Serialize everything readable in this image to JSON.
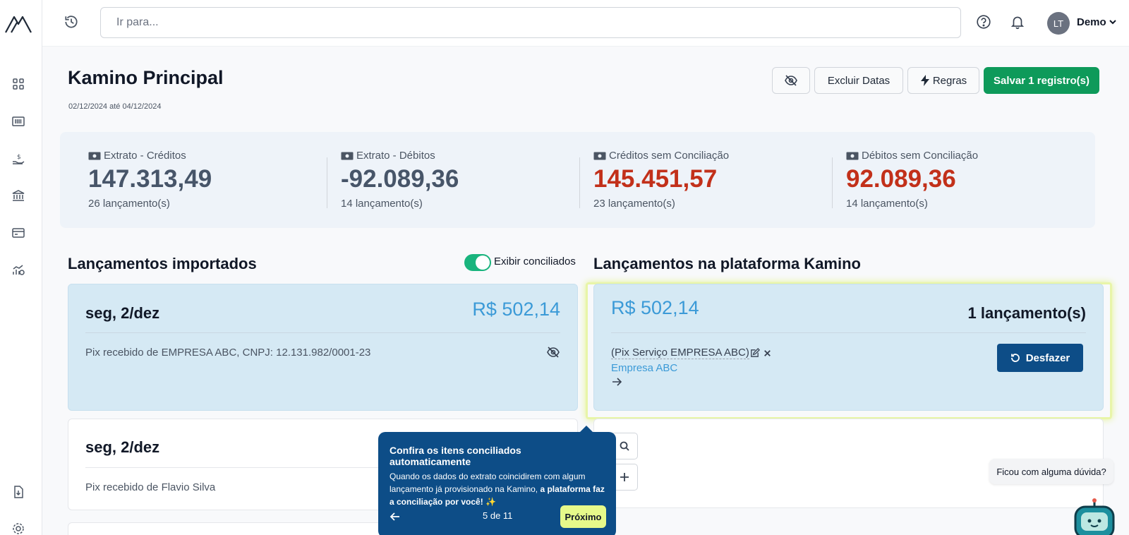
{
  "topbar": {
    "search_placeholder": "Ir para...",
    "user_initials": "LT",
    "user_name": "Demo"
  },
  "page": {
    "title": "Kamino Principal",
    "date_range": "02/12/2024 até 04/12/2024"
  },
  "actions": {
    "excluir_label": "Excluir Datas",
    "regras_label": "Regras",
    "salvar_label": "Salvar 1 registro(s)"
  },
  "stats": [
    {
      "label": "Extrato - Créditos",
      "value": "147.313,49",
      "count": "26 lançamento(s)"
    },
    {
      "label": "Extrato - Débitos",
      "value": "-92.089,36",
      "count": "14 lançamento(s)"
    },
    {
      "label": "Créditos sem Conciliação",
      "value": "145.451,57",
      "count": "23 lançamento(s)"
    },
    {
      "label": "Débitos sem Conciliação",
      "value": "92.089,36",
      "count": "14 lançamento(s)"
    }
  ],
  "imported": {
    "title": "Lançamentos importados",
    "toggle_label": "Exibir conciliados",
    "toggle_on": true,
    "items": [
      {
        "date": "seg, 2/dez",
        "amount": "R$ 502,14",
        "description": "Pix recebido de EMPRESA ABC, CNPJ: 12.131.982/0001-23"
      },
      {
        "date": "seg, 2/dez",
        "description": "Pix recebido de Flavio Silva"
      }
    ]
  },
  "platform": {
    "title": "Lançamentos na plataforma Kamino",
    "card": {
      "amount": "R$ 502,14",
      "count": "1 lançamento(s)",
      "description": "(Pix Serviço EMPRESA ABC)",
      "company": "Empresa ABC",
      "undo_label": "Desfazer"
    }
  },
  "tour": {
    "title": "Confira os itens conciliados automaticamente",
    "body_plain": "Quando os dados do extrato coincidirem com algum lançamento já provisionado na Kamino, ",
    "body_bold": "a plataforma faz a conciliação por você! ✨",
    "step": "5 de 11",
    "next_label": "Próximo"
  },
  "help_bubble": "Ficou com alguma dúvida?",
  "colors": {
    "primary_green": "#0e9a5a",
    "navy": "#0d4d87",
    "red": "#c2301a",
    "accent_blue": "#3b9ad7",
    "tour_next": "#e6f98a"
  }
}
